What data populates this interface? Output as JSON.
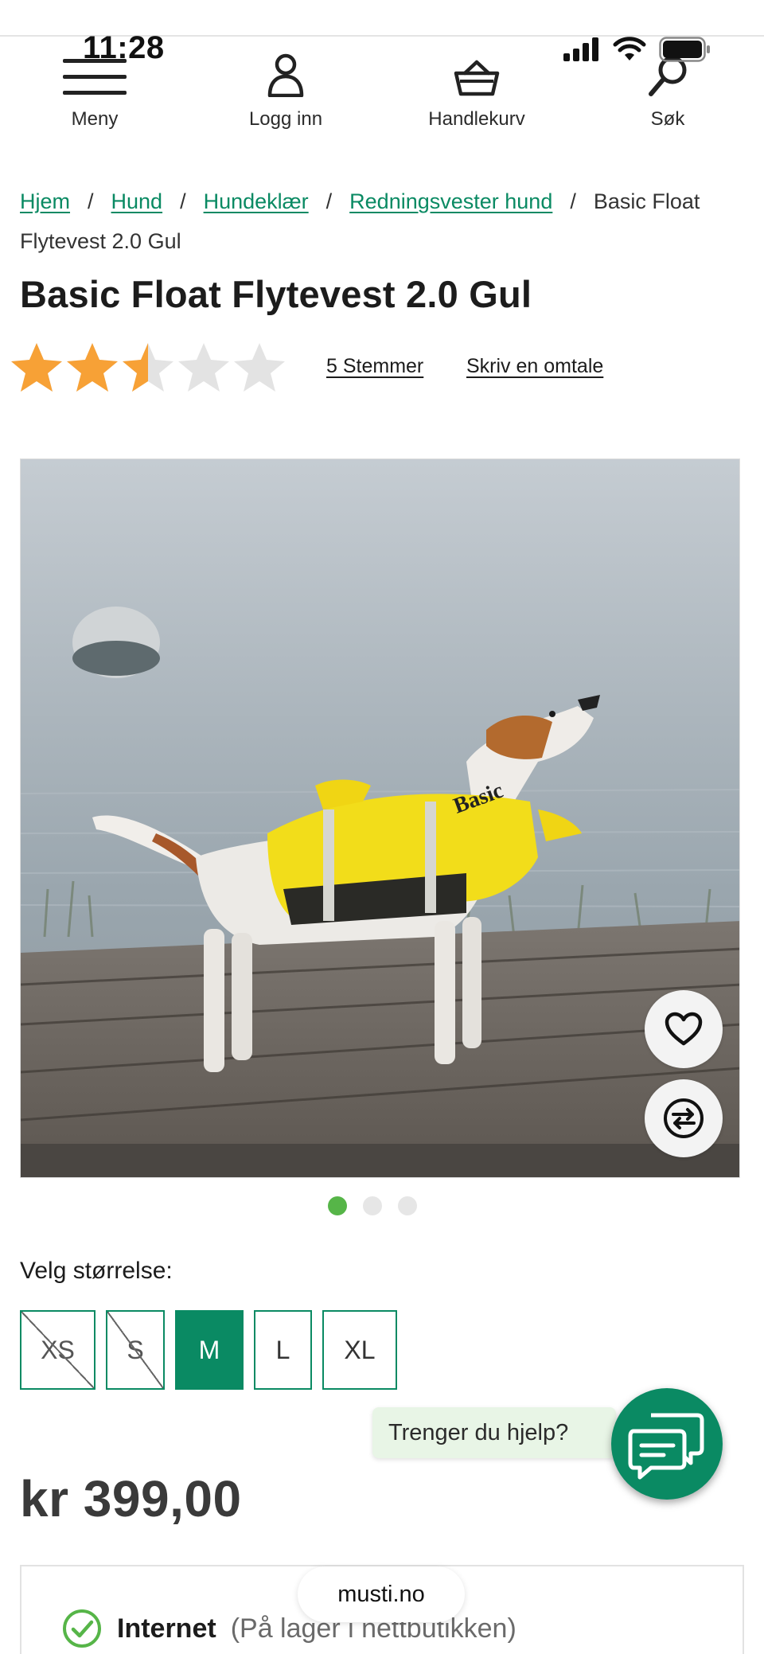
{
  "status_bar": {
    "time": "11:28"
  },
  "nav": {
    "menu_label": "Meny",
    "login_label": "Logg inn",
    "cart_label": "Handlekurv",
    "search_label": "Søk"
  },
  "breadcrumb": {
    "items": [
      "Hjem",
      "Hund",
      "Hundeklær",
      "Redningsvester hund"
    ],
    "current": "Basic Float Flytevest 2.0 Gul",
    "separator": "/"
  },
  "product": {
    "title": "Basic Float Flytevest 2.0 Gul",
    "rating": 2.5,
    "rating_max": 5,
    "votes_label": "5 Stemmer",
    "write_review_label": "Skriv en omtale",
    "image_count": 3,
    "active_image": 1,
    "size_label": "Velg størrelse:",
    "sizes": [
      {
        "label": "XS",
        "state": "unavailable"
      },
      {
        "label": "S",
        "state": "unavailable"
      },
      {
        "label": "M",
        "state": "selected"
      },
      {
        "label": "L",
        "state": "available"
      },
      {
        "label": "XL",
        "state": "available"
      }
    ],
    "price": "kr 399,00"
  },
  "help": {
    "bubble_text": "Trenger du hjelp?"
  },
  "stock": {
    "channel": "Internet",
    "note": "(På lager i nettbutikken)"
  },
  "browser": {
    "url": "musti.no"
  },
  "colors": {
    "brand_green": "#0a8a63",
    "star_filled": "#f7a136",
    "star_empty": "#e3e3e3",
    "dot_active": "#56b548"
  }
}
